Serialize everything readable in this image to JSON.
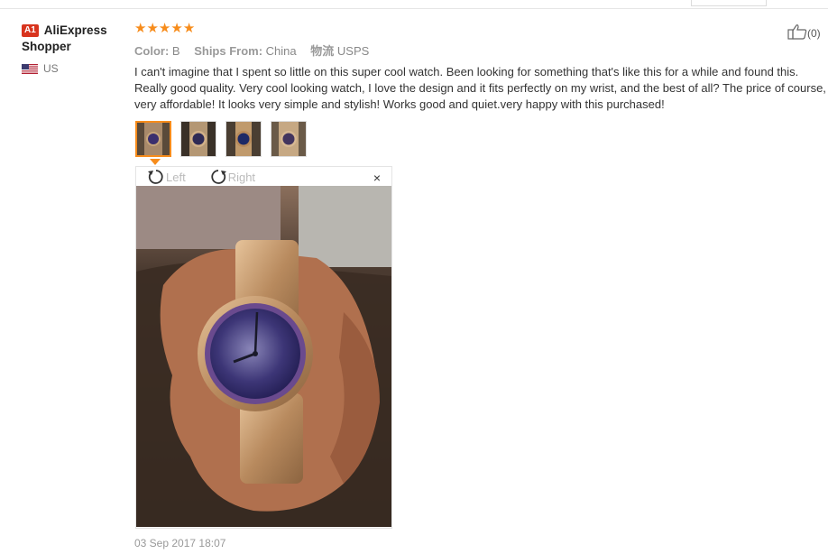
{
  "reviewer": {
    "badge": "A1",
    "name_line1": "AliExpress",
    "name_line2": "Shopper",
    "country": "US",
    "flag_icon": "us-flag-icon"
  },
  "rating": {
    "stars": 5,
    "max": 5,
    "color": "#f78c1b"
  },
  "meta": {
    "color_key": "Color:",
    "color_value": "B",
    "ships_key": "Ships From:",
    "ships_value": "China",
    "logistics_key": "物流",
    "logistics_value": "USPS"
  },
  "review_text": "I can't imagine that I spent so little on this super cool watch. Been looking for something that's like this for a while and found this. Really good quality. Very cool looking watch, I love the design and it fits perfectly on my wrist, and the best of all? The price of course, very affordable! It looks very simple and stylish! Works good and quiet.very happy with this purchased!",
  "viewer": {
    "rotate_left": "Left",
    "rotate_right": "Right",
    "close": "×"
  },
  "date": "03 Sep 2017 18:07",
  "helpful": {
    "count": "(0)"
  },
  "colors": {
    "accent": "#f78c1b",
    "badge": "#d8341e"
  }
}
